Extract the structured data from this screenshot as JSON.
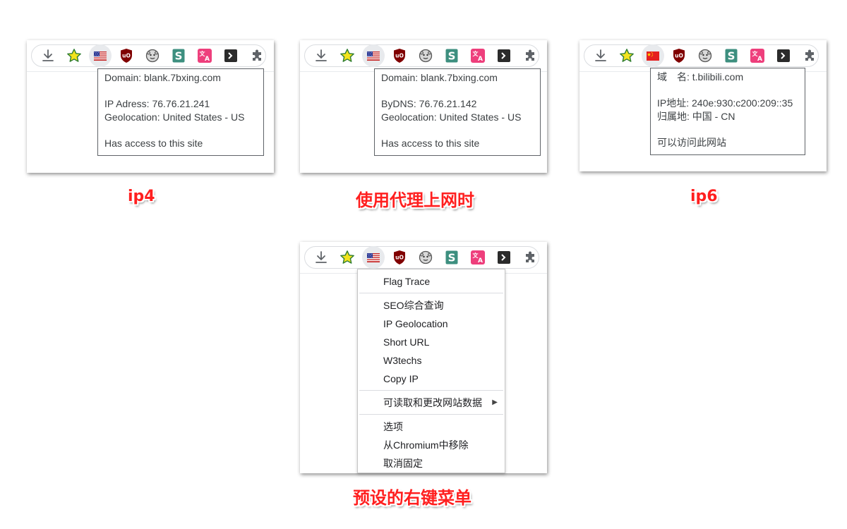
{
  "panels": [
    {
      "caption": "ip4",
      "flag": "us-flag",
      "tooltip": {
        "line1": "Domain:  blank.7bxing.com",
        "line2": "IP Adress:  76.76.21.241",
        "line3": "Geolocation:  United States - US",
        "line4": "Has access to this site"
      }
    },
    {
      "caption": "使用代理上网时",
      "flag": "us-flag",
      "tooltip": {
        "line1": "Domain:  blank.7bxing.com",
        "line2": "ByDNS:  76.76.21.142",
        "line3": "Geolocation:  United States - US",
        "line4": "Has access to this site"
      }
    },
    {
      "caption": "ip6",
      "flag": "cn-flag",
      "tooltip": {
        "line1": "域　名:  t.bilibili.com",
        "line2": "IP地址:  240e:930:c200:209::35",
        "line3": "归属地:  中国 - CN",
        "line4": "可以访问此网站"
      }
    },
    {
      "caption": "预设的右键菜单",
      "flag": "us-flag"
    }
  ],
  "toolbar_icons": [
    "download-icon",
    "star-icon",
    "flag-icon",
    "ublock-icon",
    "monkey-icon",
    "s-extension-icon",
    "translate-icon",
    "terminal-icon",
    "puzzle-extensions-icon"
  ],
  "context_menu": {
    "item1": "Flag Trace",
    "item2": "SEO综合查询",
    "item3": "IP Geolocation",
    "item4": "Short URL",
    "item5": "W3techs",
    "item6": "Copy IP",
    "item7": "可读取和更改网站数据",
    "item8": "选项",
    "item9": "从Chromium中移除",
    "item10": "取消固定"
  },
  "colors": {
    "caption": "#ff1f1f",
    "ublock": "#800000",
    "s_ext": "#3d8f7f",
    "translate": "#ee3f7c"
  }
}
